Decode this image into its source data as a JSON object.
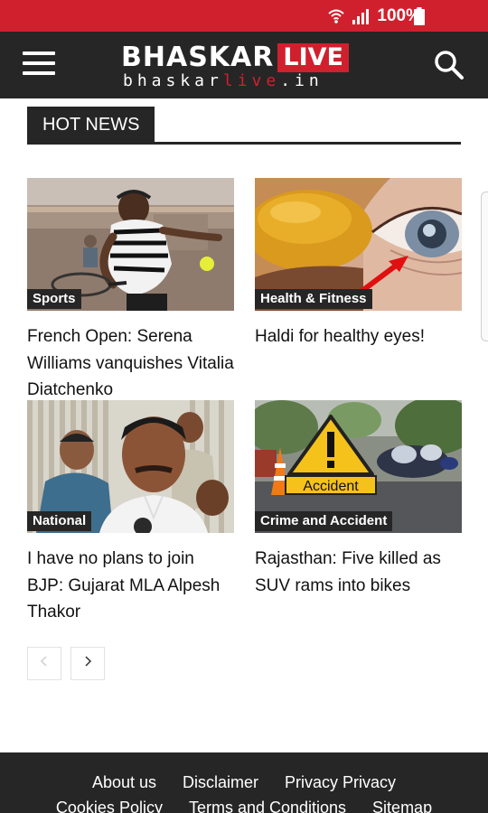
{
  "status_bar": {
    "battery": "100%",
    "icons": [
      "wifi-icon",
      "signal-icon",
      "battery-icon"
    ],
    "background_color": "#d0202e"
  },
  "header": {
    "logo_text": "BHASKAR",
    "logo_badge": "LIVE",
    "logo_sub_prefix": "bhaskar",
    "logo_sub_accent": "live",
    "logo_sub_suffix": ".in",
    "menu_icon": "hamburger-menu-icon",
    "search_icon": "search-icon",
    "background_color": "#262626",
    "accent_color": "#d0202e"
  },
  "section": {
    "title": "HOT NEWS"
  },
  "articles": [
    {
      "category": "Sports",
      "title": "French Open: Serena Williams vanquishes Vitalia Diatchenko"
    },
    {
      "category": "Health & Fitness",
      "title": "Haldi for healthy eyes!"
    },
    {
      "category": "National",
      "title": "I have no plans to join BJP: Gujarat MLA Alpesh Thakor"
    },
    {
      "category": "Crime and Accident",
      "title": "Rajasthan: Five killed as SUV rams into bikes"
    }
  ],
  "images": {
    "accident_sign": "Accident"
  },
  "pagination": {
    "prev_icon": "chevron-left-icon",
    "next_icon": "chevron-right-icon"
  },
  "footer": {
    "links_row1": [
      "About us",
      "Disclaimer",
      "Privacy Privacy"
    ],
    "links_row2": [
      "Cookies Policy",
      "Terms and Conditions",
      "Sitemap"
    ]
  }
}
